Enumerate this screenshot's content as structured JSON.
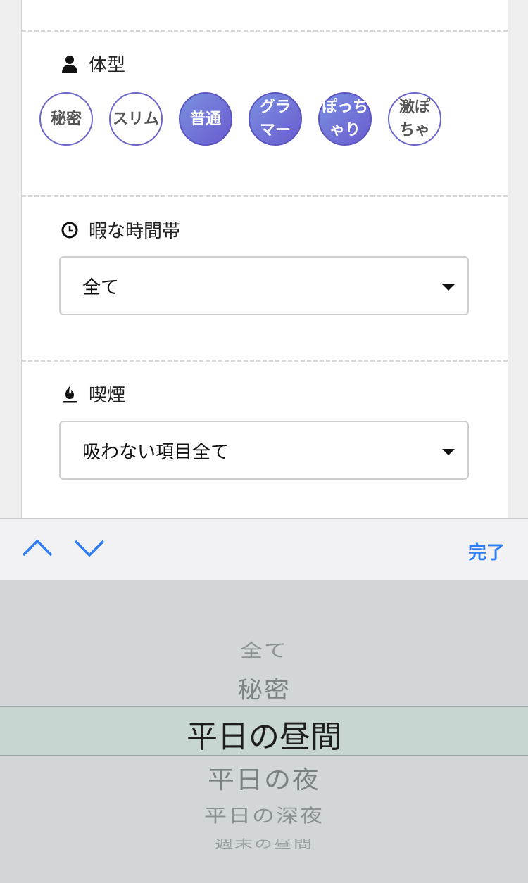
{
  "sections": {
    "body_type": {
      "title": "体型",
      "icon": "person-icon",
      "options": [
        {
          "label": "秘密",
          "selected": false
        },
        {
          "label": "スリム",
          "selected": false
        },
        {
          "label": "普通",
          "selected": true
        },
        {
          "label": "グラマー",
          "selected": true
        },
        {
          "label": "ぽっちゃり",
          "selected": true
        },
        {
          "label": "激ぽちゃ",
          "selected": false
        }
      ]
    },
    "free_time": {
      "title": "暇な時間帯",
      "icon": "clock-icon",
      "value": "全て"
    },
    "smoking": {
      "title": "喫煙",
      "icon": "flame-icon",
      "value": "吸わない項目全て"
    }
  },
  "toolbar": {
    "done_label": "完了",
    "prev_icon": "chevron-up-icon",
    "next_icon": "chevron-down-icon",
    "accent_color": "#2f7df6"
  },
  "picker": {
    "options": [
      "全て",
      "秘密",
      "平日の昼間",
      "平日の夜",
      "平日の深夜",
      "週末の昼間"
    ],
    "selected": "平日の昼間"
  }
}
